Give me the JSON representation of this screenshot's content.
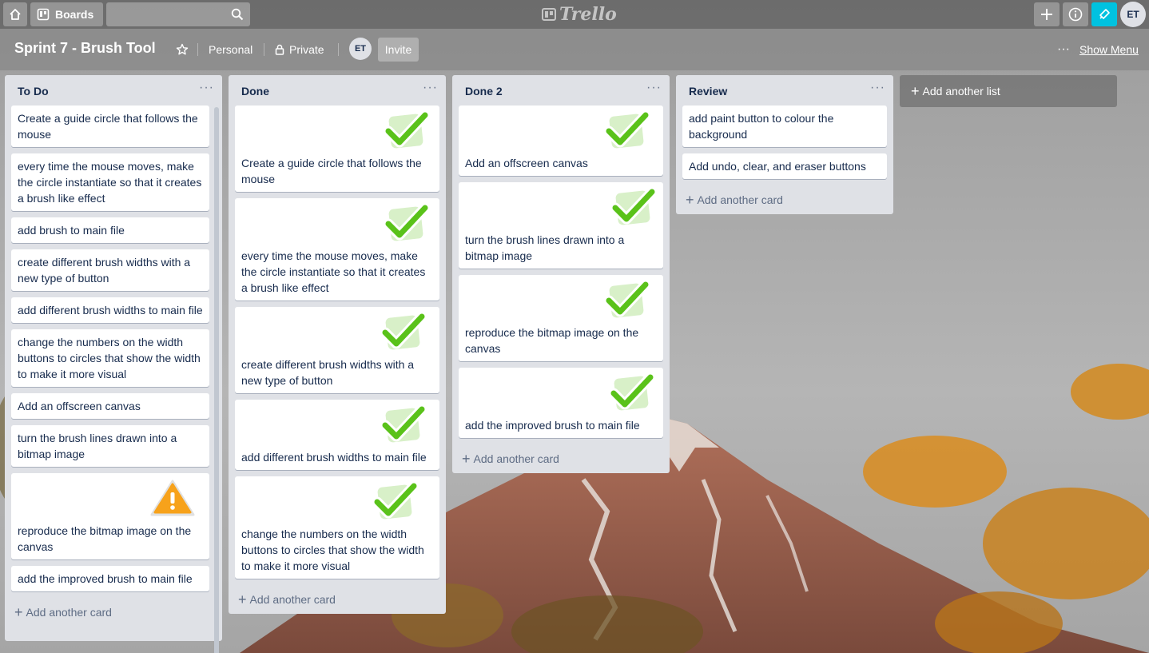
{
  "topbar": {
    "boards_label": "Boards",
    "logo_text": "Trello",
    "avatar_initials": "ET"
  },
  "board": {
    "title": "Sprint 7 - Brush Tool",
    "team_label": "Personal",
    "visibility_label": "Private",
    "member_initials": "ET",
    "invite_label": "Invite",
    "menu_label": "Show Menu"
  },
  "lists": [
    {
      "title": "To Do",
      "add_label": "Add another card",
      "cards": [
        {
          "text": "Create a guide circle that follows the mouse"
        },
        {
          "text": "every time the mouse moves, make the circle instantiate so that it creates a brush like effect"
        },
        {
          "text": "add brush to main file"
        },
        {
          "text": "create different brush widths with a new type of button"
        },
        {
          "text": "add different brush widths to main file"
        },
        {
          "text": "change the numbers on the width buttons to circles that show the width to make it more visual"
        },
        {
          "text": "Add an offscreen canvas"
        },
        {
          "text": "turn the brush lines drawn into a bitmap image"
        },
        {
          "text": "reproduce the bitmap image on the canvas",
          "cover": "warning-icon"
        },
        {
          "text": "add the improved brush to main file"
        }
      ]
    },
    {
      "title": "Done",
      "add_label": "Add another card",
      "cards": [
        {
          "text": "Create a guide circle that follows the mouse",
          "cover": "checkmark-icon"
        },
        {
          "text": "every time the mouse moves, make the circle instantiate so that it creates a brush like effect",
          "cover": "checkmark-icon"
        },
        {
          "text": "create different brush widths with a new type of button",
          "cover": "checkmark-icon"
        },
        {
          "text": "add different brush widths to main file",
          "cover": "checkmark-icon"
        },
        {
          "text": "change the numbers on the width buttons to circles that show the width to make it more visual",
          "cover": "checkmark-icon"
        }
      ]
    },
    {
      "title": "Done 2",
      "add_label": "Add another card",
      "cards": [
        {
          "text": "Add an offscreen canvas",
          "cover": "checkmark-icon"
        },
        {
          "text": "turn the brush lines drawn into a bitmap image",
          "cover": "checkmark-icon"
        },
        {
          "text": "reproduce the bitmap image on the canvas",
          "cover": "checkmark-icon"
        },
        {
          "text": "add the improved brush to main file",
          "cover": "checkmark-icon"
        }
      ]
    },
    {
      "title": "Review",
      "add_label": "Add another card",
      "cards": [
        {
          "text": "add paint button to colour the background"
        },
        {
          "text": "Add undo, clear, and eraser buttons"
        }
      ]
    }
  ],
  "add_list_label": "Add another list",
  "colors": {
    "notification_accent": "#00c2e0",
    "list_background": "#dfe1e6",
    "check_green": "#5ac21a",
    "warning_orange": "#f7a21b"
  }
}
